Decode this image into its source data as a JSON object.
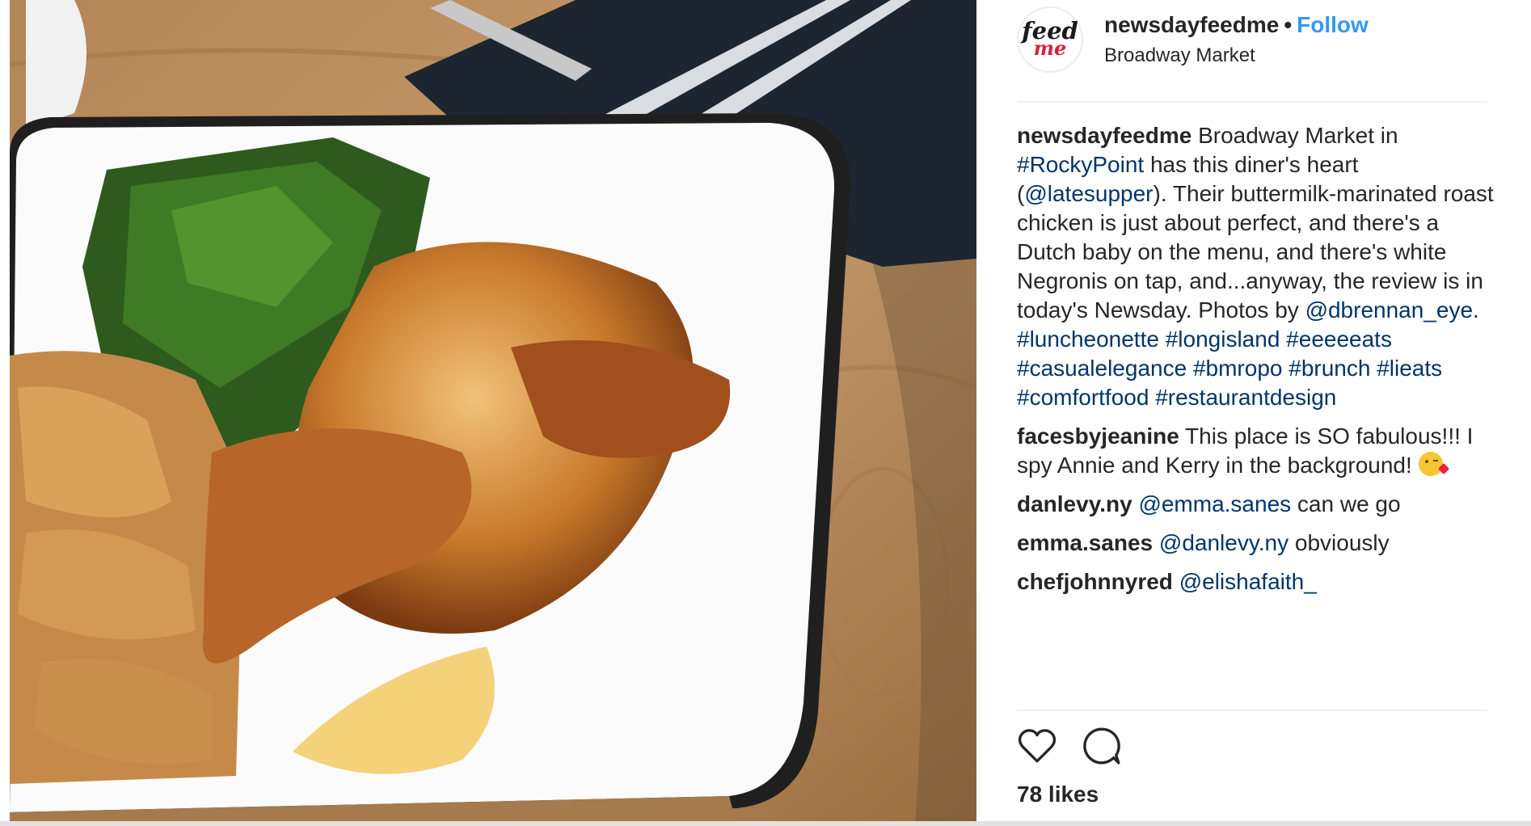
{
  "post": {
    "username": "newsdayfeedme",
    "separator": "•",
    "follow_label": "Follow",
    "location": "Broadway Market",
    "avatar": {
      "line1": "feed",
      "line2": "me"
    }
  },
  "caption": {
    "user": "newsdayfeedme",
    "t1": " Broadway Market in ",
    "h1": "#RockyPoint",
    "t2": " has this diner's heart (",
    "m1": "@latesupper",
    "t3": "). Their buttermilk-marinated roast chicken is just about perfect, and there's a Dutch baby on the menu, and there's white Negronis on tap, and...anyway, the review is in today's Newsday. Photos by ",
    "m2": "@dbrennan_eye",
    "t4": ". ",
    "h2": "#luncheonette",
    "h3": "#longisland",
    "h4": "#eeeeeats",
    "h5": "#casualelegance",
    "h6": "#bmropo",
    "h7": "#brunch",
    "h8": "#lieats",
    "h9": "#comfortfood",
    "h10": "#restaurantdesign"
  },
  "comments": [
    {
      "user": "facesbyjeanine",
      "text": " This place is SO fabulous!!! I spy Annie and Kerry in the background! "
    },
    {
      "user": "danlevy.ny",
      "mention": "@emma.sanes",
      "text": " can we go"
    },
    {
      "user": "emma.sanes",
      "mention": "@danlevy.ny",
      "text": " obviously"
    },
    {
      "user": "chefjohnnyred",
      "mention": "@elishafaith_",
      "text": ""
    }
  ],
  "likes": "78 likes",
  "icons": {
    "like": "heart-icon",
    "comment": "comment-icon",
    "emoji": "kiss-emoji-icon"
  },
  "colors": {
    "link": "#003569",
    "follow": "#3897f0",
    "text": "#262626"
  }
}
